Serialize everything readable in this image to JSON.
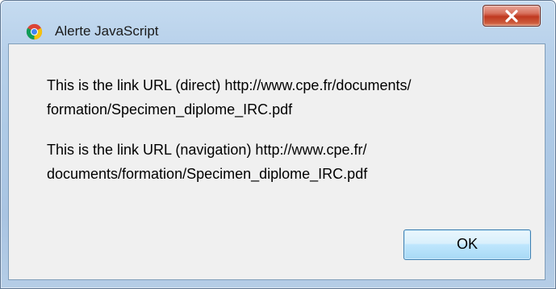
{
  "window": {
    "title": "Alerte JavaScript",
    "app_icon": "chrome-icon",
    "close_icon": "close-icon"
  },
  "dialog": {
    "message_direct": "This is the link URL (direct) http://www.cpe.fr/documents/\nformation/Specimen_diplome_IRC.pdf",
    "message_navigation": "This is the link URL (navigation) http://www.cpe.fr/\ndocuments/formation/Specimen_diplome_IRC.pdf",
    "ok_label": "OK"
  },
  "colors": {
    "close_button": "#c7452a",
    "frame": "#b3cde8",
    "client_background": "#f0f0f0",
    "ok_button": "#bee6fd"
  }
}
